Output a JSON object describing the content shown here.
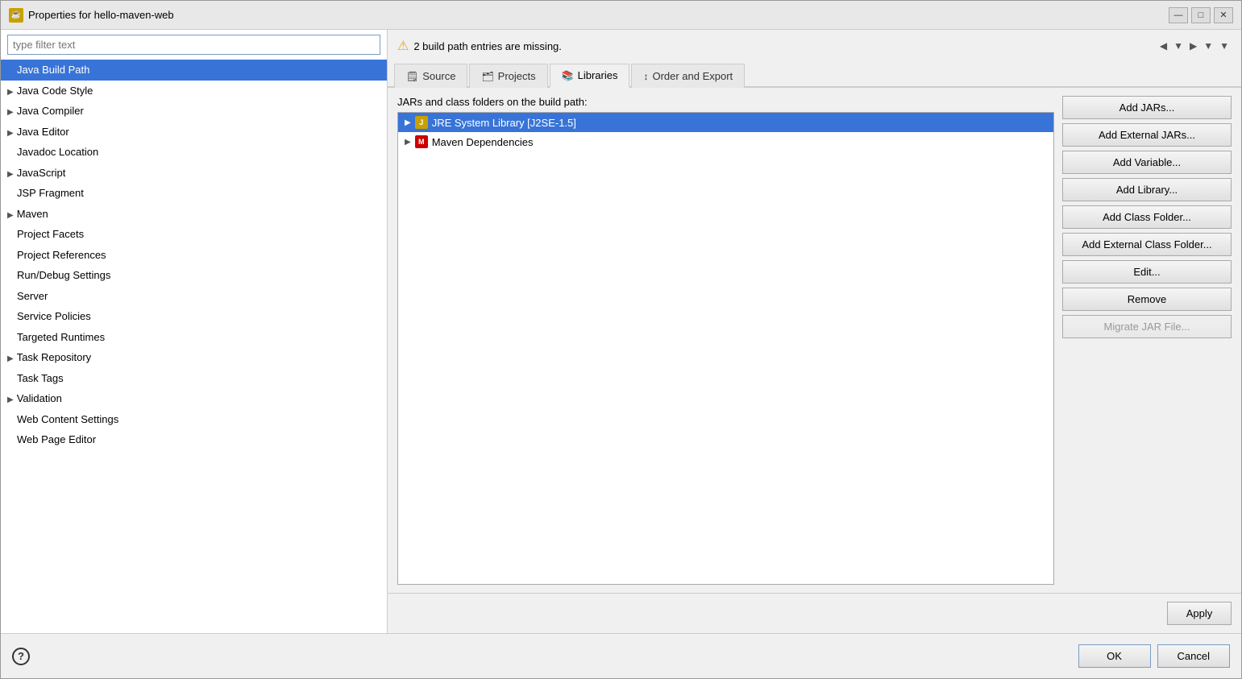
{
  "window": {
    "title": "Properties for hello-maven-web",
    "icon_label": "P",
    "controls": {
      "minimize": "—",
      "maximize": "□",
      "close": "✕"
    }
  },
  "left_panel": {
    "filter_placeholder": "type filter text",
    "tree_items": [
      {
        "id": "java-build-path",
        "label": "Java Build Path",
        "selected": true,
        "arrow": false
      },
      {
        "id": "java-code-style",
        "label": "Java Code Style",
        "selected": false,
        "arrow": true
      },
      {
        "id": "java-compiler",
        "label": "Java Compiler",
        "selected": false,
        "arrow": true
      },
      {
        "id": "java-editor",
        "label": "Java Editor",
        "selected": false,
        "arrow": true
      },
      {
        "id": "javadoc-location",
        "label": "Javadoc Location",
        "selected": false,
        "arrow": false
      },
      {
        "id": "javascript",
        "label": "JavaScript",
        "selected": false,
        "arrow": true
      },
      {
        "id": "jsp-fragment",
        "label": "JSP Fragment",
        "selected": false,
        "arrow": false
      },
      {
        "id": "maven",
        "label": "Maven",
        "selected": false,
        "arrow": true
      },
      {
        "id": "project-facets",
        "label": "Project Facets",
        "selected": false,
        "arrow": false
      },
      {
        "id": "project-references",
        "label": "Project References",
        "selected": false,
        "arrow": false
      },
      {
        "id": "run-debug-settings",
        "label": "Run/Debug Settings",
        "selected": false,
        "arrow": false
      },
      {
        "id": "server",
        "label": "Server",
        "selected": false,
        "arrow": false
      },
      {
        "id": "service-policies",
        "label": "Service Policies",
        "selected": false,
        "arrow": false
      },
      {
        "id": "targeted-runtimes",
        "label": "Targeted Runtimes",
        "selected": false,
        "arrow": false
      },
      {
        "id": "task-repository",
        "label": "Task Repository",
        "selected": false,
        "arrow": true
      },
      {
        "id": "task-tags",
        "label": "Task Tags",
        "selected": false,
        "arrow": false
      },
      {
        "id": "validation",
        "label": "Validation",
        "selected": false,
        "arrow": true
      },
      {
        "id": "web-content-settings",
        "label": "Web Content Settings",
        "selected": false,
        "arrow": false
      },
      {
        "id": "web-page-editor",
        "label": "Web Page Editor",
        "selected": false,
        "arrow": false
      }
    ]
  },
  "right_panel": {
    "warning_message": "2 build path entries are missing.",
    "warning_icon": "⚠",
    "tabs": [
      {
        "id": "source",
        "label": "Source",
        "icon": "📄",
        "active": false
      },
      {
        "id": "projects",
        "label": "Projects",
        "icon": "📁",
        "active": false
      },
      {
        "id": "libraries",
        "label": "Libraries",
        "icon": "📚",
        "active": true
      },
      {
        "id": "order-and-export",
        "label": "Order and Export",
        "icon": "↕",
        "active": false
      }
    ],
    "panel_label": "JARs and class folders on the build path:",
    "jar_items": [
      {
        "id": "jre-system-library",
        "label": "JRE System Library [J2SE-1.5]",
        "selected": true,
        "type": "jre"
      },
      {
        "id": "maven-dependencies",
        "label": "Maven Dependencies",
        "selected": false,
        "type": "maven"
      }
    ],
    "buttons": [
      {
        "id": "add-jars",
        "label": "Add JARs...",
        "disabled": false
      },
      {
        "id": "add-external-jars",
        "label": "Add External JARs...",
        "disabled": false
      },
      {
        "id": "add-variable",
        "label": "Add Variable...",
        "disabled": false
      },
      {
        "id": "add-library",
        "label": "Add Library...",
        "disabled": false
      },
      {
        "id": "add-class-folder",
        "label": "Add Class Folder...",
        "disabled": false
      },
      {
        "id": "add-external-class-folder",
        "label": "Add External Class Folder...",
        "disabled": false
      },
      {
        "id": "edit",
        "label": "Edit...",
        "disabled": false
      },
      {
        "id": "remove",
        "label": "Remove",
        "disabled": false
      },
      {
        "id": "migrate-jar-file",
        "label": "Migrate JAR File...",
        "disabled": true
      }
    ]
  },
  "footer": {
    "apply_label": "Apply",
    "ok_label": "OK",
    "cancel_label": "Cancel",
    "help_icon": "?"
  }
}
